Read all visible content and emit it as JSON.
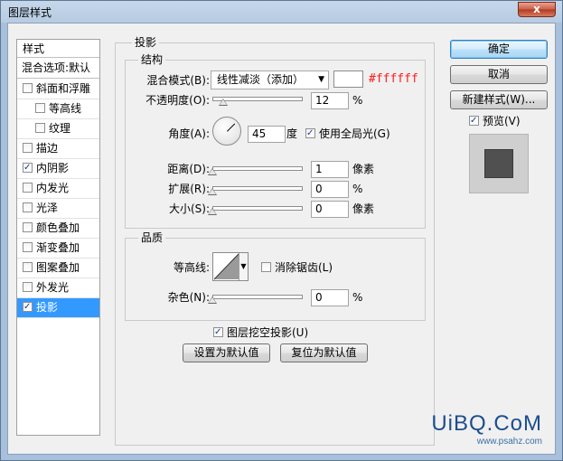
{
  "window": {
    "title": "图层样式",
    "close_label": "x"
  },
  "left_panel": {
    "header": "样式",
    "blend_default": "混合选项:默认",
    "items": [
      {
        "label": "斜面和浮雕",
        "checked": false,
        "indent": false,
        "selected": false
      },
      {
        "label": "等高线",
        "checked": false,
        "indent": true,
        "selected": false
      },
      {
        "label": "纹理",
        "checked": false,
        "indent": true,
        "selected": false
      },
      {
        "label": "描边",
        "checked": false,
        "indent": false,
        "selected": false
      },
      {
        "label": "内阴影",
        "checked": true,
        "indent": false,
        "selected": false
      },
      {
        "label": "内发光",
        "checked": false,
        "indent": false,
        "selected": false
      },
      {
        "label": "光泽",
        "checked": false,
        "indent": false,
        "selected": false
      },
      {
        "label": "颜色叠加",
        "checked": false,
        "indent": false,
        "selected": false
      },
      {
        "label": "渐变叠加",
        "checked": false,
        "indent": false,
        "selected": false
      },
      {
        "label": "图案叠加",
        "checked": false,
        "indent": false,
        "selected": false
      },
      {
        "label": "外发光",
        "checked": false,
        "indent": false,
        "selected": false
      },
      {
        "label": "投影",
        "checked": true,
        "indent": false,
        "selected": true
      }
    ]
  },
  "drop_shadow": {
    "title": "投影",
    "structure": {
      "title": "结构",
      "blend_mode_label": "混合模式(B):",
      "blend_mode_value": "线性减淡（添加）",
      "color_swatch": "#ffffff",
      "color_hex_text": "#ffffff",
      "opacity_label": "不透明度(O):",
      "opacity_value": "12",
      "opacity_unit": "%",
      "opacity_fraction": 0.12,
      "angle_label": "角度(A):",
      "angle_value": "45",
      "angle_unit": "度",
      "global_light_label": "使用全局光(G)",
      "global_light_checked": true,
      "distance_label": "距离(D):",
      "distance_value": "1",
      "distance_unit": "像素",
      "spread_label": "扩展(R):",
      "spread_value": "0",
      "spread_unit": "%",
      "size_label": "大小(S):",
      "size_value": "0",
      "size_unit": "像素"
    },
    "quality": {
      "title": "品质",
      "contour_label": "等高线:",
      "anti_alias_label": "消除锯齿(L)",
      "anti_alias_checked": false,
      "noise_label": "杂色(N):",
      "noise_value": "0",
      "noise_unit": "%"
    },
    "knockout_label": "图层挖空投影(U)",
    "knockout_checked": true,
    "set_default_label": "设置为默认值",
    "reset_default_label": "复位为默认值"
  },
  "right_panel": {
    "ok_label": "确定",
    "cancel_label": "取消",
    "new_style_label": "新建样式(W)...",
    "preview_label": "预览(V)",
    "preview_checked": true
  },
  "watermark": {
    "main": "UiBQ.CoM",
    "sub": "www.psahz.com"
  }
}
